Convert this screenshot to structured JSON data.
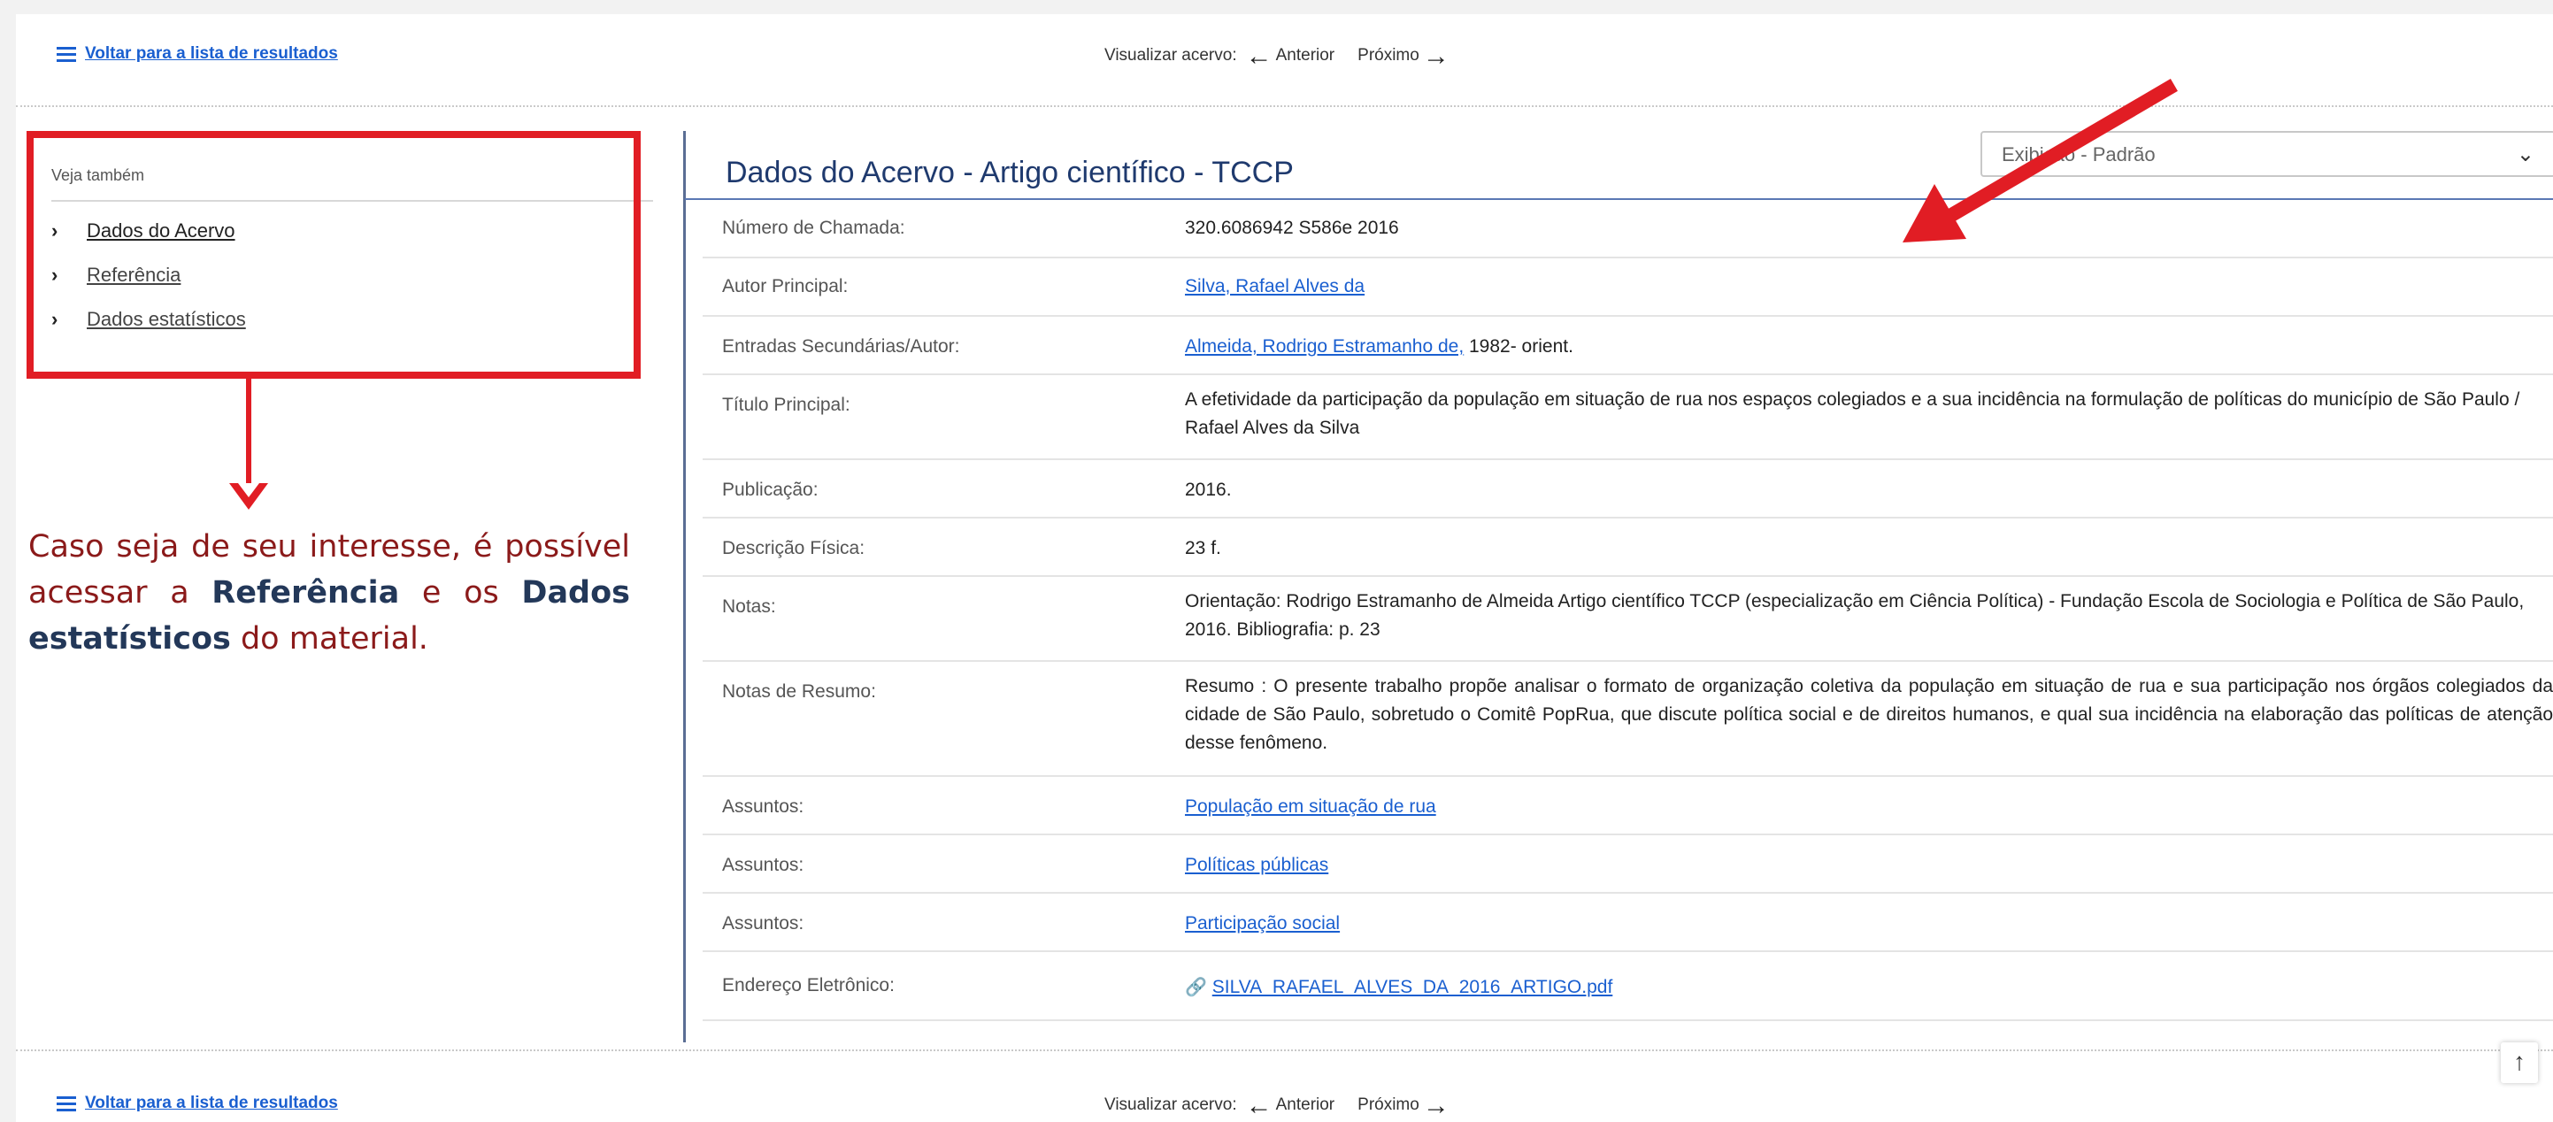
{
  "nav": {
    "back_label": "Voltar para a lista de resultados",
    "browse_label": "Visualizar acervo:",
    "prev_label": "Anterior",
    "next_label": "Próximo"
  },
  "sidebar": {
    "title": "Veja também",
    "items": [
      {
        "label": "Dados do Acervo"
      },
      {
        "label": "Referência"
      },
      {
        "label": "Dados estatísticos"
      }
    ]
  },
  "callout": {
    "t1": "Caso seja de seu interesse, é possível acessar a ",
    "t2": "Referência",
    "t3": " e os ",
    "t4": "Dados estatísticos",
    "t5": " do material."
  },
  "main": {
    "title": "Dados do Acervo - Artigo científico - TCCP",
    "select_value": "Exibição - Padrão",
    "rows": [
      {
        "label": "Número de Chamada:",
        "value": "320.6086942  S586e  2016"
      },
      {
        "label": "Autor Principal:",
        "value": "Silva, Rafael Alves da"
      },
      {
        "label": "Entradas Secundárias/Autor:",
        "value": "Almeida, Rodrigo Estramanho de,",
        "value2": " 1982-  orient."
      },
      {
        "label": "Título Principal:",
        "value": "A efetividade da participação da população em situação de rua nos espaços colegiados e a sua incidência na formulação de políticas do município de São Paulo /  Rafael Alves da Silva"
      },
      {
        "label": "Publicação:",
        "value": "2016."
      },
      {
        "label": "Descrição Física:",
        "value": "23 f."
      },
      {
        "label": "Notas:",
        "value": "Orientação: Rodrigo Estramanho de Almeida  Artigo científico TCCP (especialização em Ciência Política) - Fundação Escola de Sociologia e Política de São Paulo, 2016.  Bibliografia: p. 23"
      },
      {
        "label": "Notas de Resumo:",
        "value": "Resumo : O presente trabalho propõe analisar o formato de organização coletiva da população em situação de rua e sua participação nos órgãos colegiados da cidade de São Paulo, sobretudo o Comitê PopRua, que discute política social e de direitos humanos, e qual sua incidência na elaboração das políticas de atenção desse fenômeno."
      },
      {
        "label": "Assuntos:",
        "value": "População em situação de rua"
      },
      {
        "label": "Assuntos:",
        "value": "Políticas públicas"
      },
      {
        "label": "Assuntos:",
        "value": "Participação social"
      },
      {
        "label": "Endereço Eletrônico:",
        "value": "SILVA_RAFAEL_ALVES_DA_2016_ARTIGO.pdf"
      }
    ]
  },
  "colors": {
    "accent_red": "#e11d24",
    "link": "#1a5fd0",
    "heading": "#1f3a6e"
  },
  "icons": [
    "list-icon",
    "arrow-left-icon",
    "arrow-right-icon",
    "chevron-right-icon",
    "chevron-down-icon",
    "link-icon",
    "arrow-up-icon"
  ]
}
